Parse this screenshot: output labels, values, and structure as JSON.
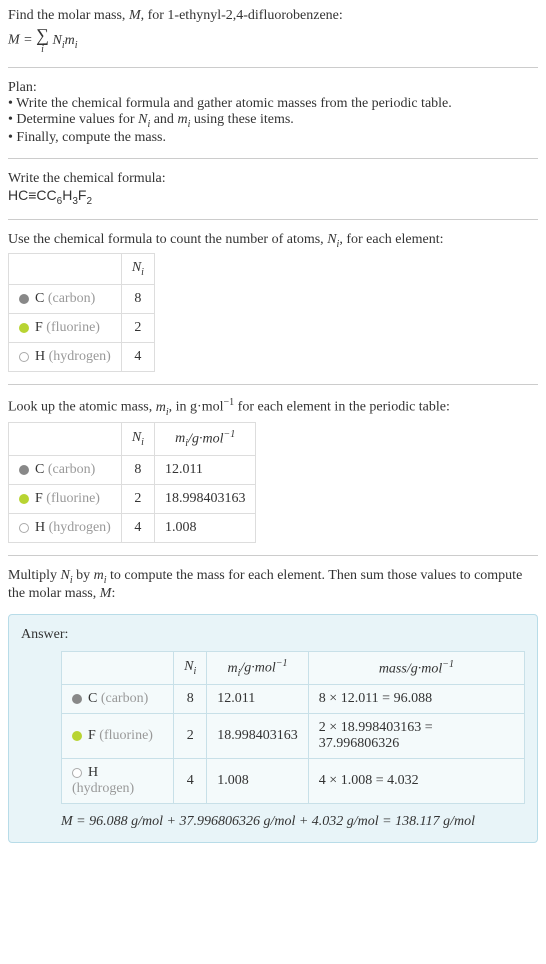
{
  "intro": {
    "line1": "Find the molar mass, ",
    "line1_var": "M",
    "line1_end": ", for 1-ethynyl-2,4-difluorobenzene:",
    "formula_lhs": "M",
    "formula_eq": " = ",
    "formula_rhs_var1": "N",
    "formula_rhs_var2": "m"
  },
  "plan": {
    "title": "Plan:",
    "items": [
      "Write the chemical formula and gather atomic masses from the periodic table.",
      "Determine values for Nᵢ and mᵢ using these items.",
      "Finally, compute the mass."
    ]
  },
  "chemformula": {
    "title": "Write the chemical formula:",
    "formula": "HC≡CC₆H₃F₂"
  },
  "count": {
    "title_start": "Use the chemical formula to count the number of atoms, ",
    "title_var": "N",
    "title_end": ", for each element:",
    "header": "Nᵢ",
    "rows": [
      {
        "symbol": "C",
        "name": "(carbon)",
        "dot": "dot-c",
        "n": "8"
      },
      {
        "symbol": "F",
        "name": "(fluorine)",
        "dot": "dot-f",
        "n": "2"
      },
      {
        "symbol": "H",
        "name": "(hydrogen)",
        "dot": "dot-h",
        "n": "4"
      }
    ]
  },
  "lookup": {
    "title_start": "Look up the atomic mass, ",
    "title_var": "m",
    "title_mid": ", in g·mol",
    "title_sup": "−1",
    "title_end": " for each element in the periodic table:",
    "header_n": "Nᵢ",
    "header_m": "mᵢ/g·mol⁻¹",
    "rows": [
      {
        "symbol": "C",
        "name": "(carbon)",
        "dot": "dot-c",
        "n": "8",
        "m": "12.011"
      },
      {
        "symbol": "F",
        "name": "(fluorine)",
        "dot": "dot-f",
        "n": "2",
        "m": "18.998403163"
      },
      {
        "symbol": "H",
        "name": "(hydrogen)",
        "dot": "dot-h",
        "n": "4",
        "m": "1.008"
      }
    ]
  },
  "multiply": {
    "text_start": "Multiply ",
    "text_var1": "Nᵢ",
    "text_mid": " by ",
    "text_var2": "mᵢ",
    "text_end": " to compute the mass for each element. Then sum those values to compute the molar mass, ",
    "text_finalvar": "M",
    "text_colon": ":"
  },
  "answer": {
    "label": "Answer:",
    "header_n": "Nᵢ",
    "header_m": "mᵢ/g·mol⁻¹",
    "header_mass": "mass/g·mol⁻¹",
    "rows": [
      {
        "symbol": "C",
        "name": "(carbon)",
        "dot": "dot-c",
        "n": "8",
        "m": "12.011",
        "mass": "8 × 12.011 = 96.088"
      },
      {
        "symbol": "F",
        "name": "(fluorine)",
        "dot": "dot-f",
        "n": "2",
        "m": "18.998403163",
        "mass": "2 × 18.998403163 = 37.996806326"
      },
      {
        "symbol": "H",
        "name": "(hydrogen)",
        "dot": "dot-h",
        "n": "4",
        "m": "1.008",
        "mass": "4 × 1.008 = 4.032"
      }
    ],
    "final": "M = 96.088 g/mol + 37.996806326 g/mol + 4.032 g/mol = 138.117 g/mol"
  },
  "chart_data": {
    "type": "table",
    "title": "Molar mass of 1-ethynyl-2,4-difluorobenzene",
    "elements": [
      {
        "element": "C (carbon)",
        "N_i": 8,
        "m_i_g_per_mol": 12.011,
        "mass_g_per_mol": 96.088
      },
      {
        "element": "F (fluorine)",
        "N_i": 2,
        "m_i_g_per_mol": 18.998403163,
        "mass_g_per_mol": 37.996806326
      },
      {
        "element": "H (hydrogen)",
        "N_i": 4,
        "m_i_g_per_mol": 1.008,
        "mass_g_per_mol": 4.032
      }
    ],
    "molar_mass_g_per_mol": 138.117
  }
}
